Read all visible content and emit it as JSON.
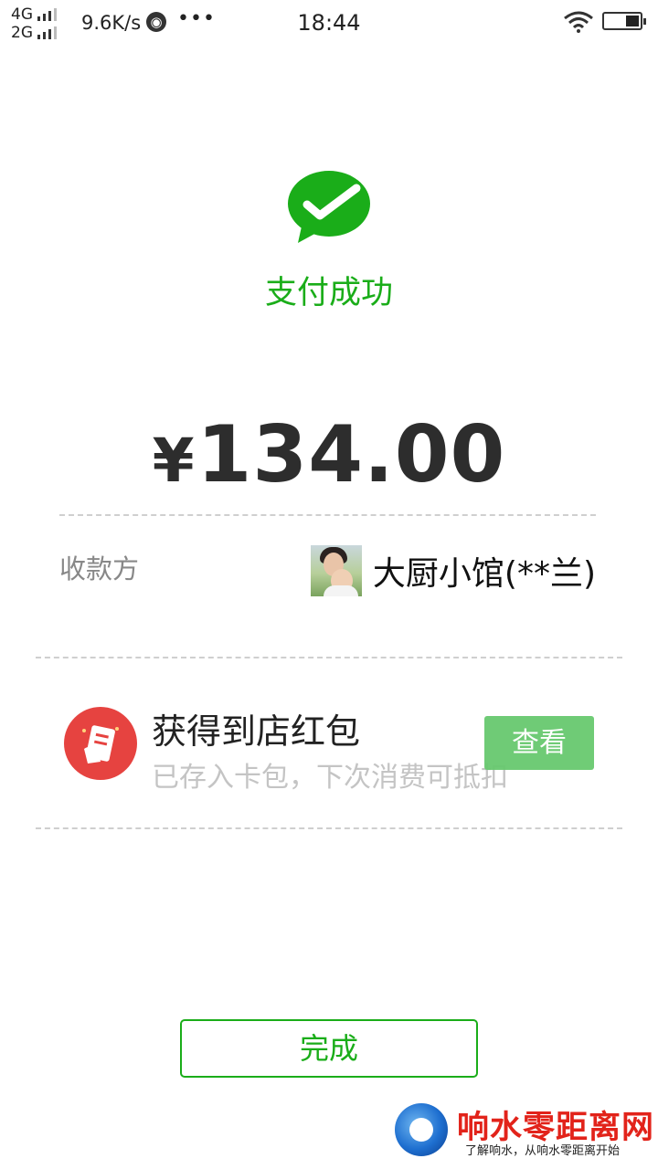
{
  "status_bar": {
    "network_top": "4G",
    "network_bottom": "2G",
    "speed": "9.6K/s",
    "dots": "•••",
    "time": "18:44"
  },
  "result": {
    "title": "支付成功",
    "currency": "¥",
    "amount": "134.00"
  },
  "payee": {
    "label": "收款方",
    "name": "大厨小馆(**兰)"
  },
  "coupon": {
    "title": "获得到店红包",
    "subtitle": "已存入卡包，下次消费可抵扣",
    "view_label": "查看"
  },
  "actions": {
    "done_label": "完成"
  },
  "watermark": {
    "title": "响水零距离网",
    "subtitle": "了解响水，从响水零距离开始"
  },
  "colors": {
    "wechat_green": "#1aad19",
    "coupon_red": "#e64340",
    "view_button": "#68c96f"
  }
}
